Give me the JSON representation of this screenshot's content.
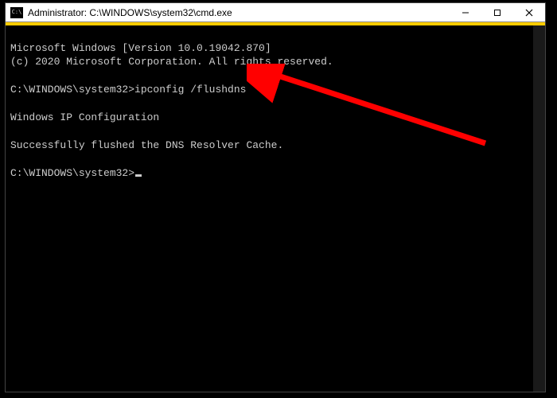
{
  "titlebar": {
    "title": "Administrator: C:\\WINDOWS\\system32\\cmd.exe"
  },
  "terminal": {
    "line1": "Microsoft Windows [Version 10.0.19042.870]",
    "line2": "(c) 2020 Microsoft Corporation. All rights reserved.",
    "blank1": "",
    "prompt1": "C:\\WINDOWS\\system32>",
    "command1": "ipconfig /flushdns",
    "blank2": "",
    "line3": "Windows IP Configuration",
    "blank3": "",
    "line4": "Successfully flushed the DNS Resolver Cache.",
    "blank4": "",
    "prompt2": "C:\\WINDOWS\\system32>"
  },
  "annotation": {
    "arrow_color": "#ff0000"
  },
  "watermark": {
    "text": ""
  }
}
